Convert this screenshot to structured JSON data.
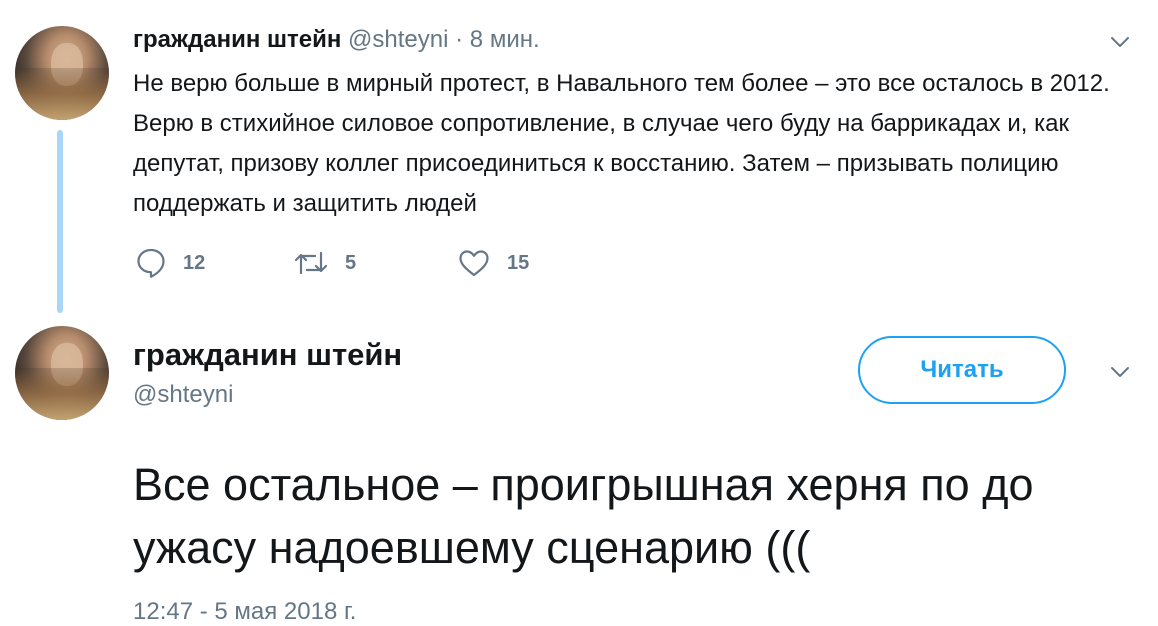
{
  "tweet1": {
    "author_name": "гражданин штейн",
    "handle": "@shteyni",
    "separator": "·",
    "time": "8 мин.",
    "text": "Не верю больше в мирный протест, в Навального тем более – это все осталось в 2012. Верю в стихийное силовое сопротивление, в случае чего буду на баррикадах и, как депутат, призову коллег присоединиться к восстанию. Затем – призывать полицию поддержать и защитить людей",
    "replies": "12",
    "retweets": "5",
    "likes": "15"
  },
  "tweet2": {
    "author_name": "гражданин штейн",
    "handle": "@shteyni",
    "follow_label": "Читать",
    "text": "Все остальное – проигрышная херня по до ужасу надоевшему сценарию (((",
    "timestamp": "12:47 - 5 мая 2018 г."
  },
  "icons": {
    "reply": "speech-bubble-icon",
    "retweet": "retweet-arrows-icon",
    "like": "heart-icon",
    "menu": "chevron-down-icon"
  },
  "colors": {
    "text": "#14171a",
    "secondary": "#657786",
    "accent": "#1da1f2",
    "thread_line": "#a8d6f4"
  }
}
